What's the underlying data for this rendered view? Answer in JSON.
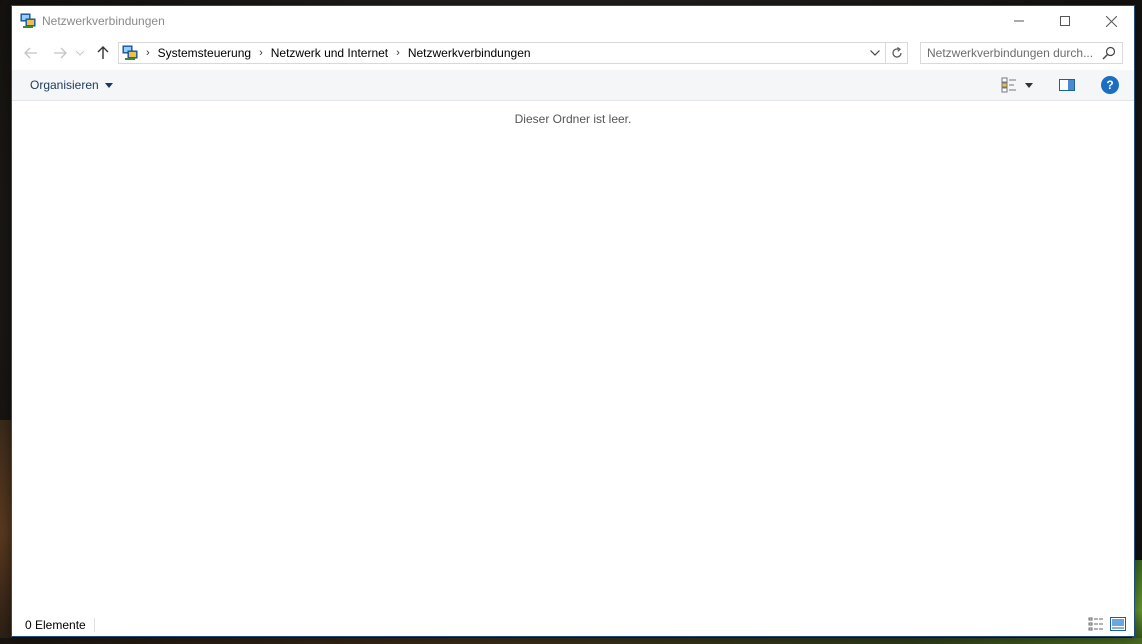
{
  "window": {
    "title": "Netzwerkverbindungen",
    "controls": {
      "minimize_icon": "minimize-icon",
      "maximize_icon": "maximize-icon",
      "close_icon": "close-icon"
    }
  },
  "navigation": {
    "back_icon": "arrow-left-icon",
    "forward_icon": "arrow-right-icon",
    "recent_icon": "chevron-down-icon",
    "up_icon": "arrow-up-icon"
  },
  "address": {
    "breadcrumbs": [
      {
        "label": "Systemsteuerung"
      },
      {
        "label": "Netzwerk und Internet"
      },
      {
        "label": "Netzwerkverbindungen"
      }
    ],
    "separator": "›",
    "dropdown_icon": "chevron-down-icon",
    "refresh_icon": "refresh-icon"
  },
  "search": {
    "placeholder": "Netzwerkverbindungen durch...",
    "value": ""
  },
  "commandbar": {
    "organize_label": "Organisieren",
    "help_label": "?"
  },
  "content": {
    "empty_message": "Dieser Ordner ist leer."
  },
  "statusbar": {
    "item_count": "0 Elemente"
  },
  "colors": {
    "accent": "#1b6ec2",
    "command_text": "#1e395b",
    "commandbar_bg": "#f5f6f7"
  }
}
